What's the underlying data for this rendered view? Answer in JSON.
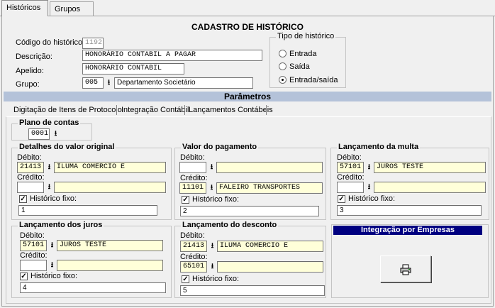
{
  "tabs": [
    {
      "label": "Históricos",
      "accel": "H"
    },
    {
      "label": "Grupos",
      "accel": "G"
    }
  ],
  "form": {
    "title": "CADASTRO DE HISTÓRICO",
    "codigo_label": "Código do histórico:",
    "codigo_value": "1192",
    "descricao_label": "Descrição:",
    "descricao_value": "HONORÁRIO CONTABIL A PAGAR",
    "apelido_label": "Apelido:",
    "apelido_value": "HONORÁRIO CONTABIL",
    "grupo_label": "Grupo:",
    "grupo_code": "005",
    "grupo_name": "Departamento Societário"
  },
  "tipo": {
    "title": "Tipo de histórico",
    "options": [
      "Entrada",
      "Saída",
      "Entrada/saída"
    ],
    "selected": "Entrada/saída"
  },
  "parametros": {
    "title": "Parâmetros",
    "subtabs": [
      "Digitação de Itens de Protocolo",
      "Integração Contábil",
      "Lançamentos Contábeis"
    ],
    "active_subtab": "Lançamentos Contábeis"
  },
  "plano": {
    "title": "Plano de contas",
    "value": "0001"
  },
  "labels": {
    "debito": "Débito:",
    "credito": "Crédito:",
    "historico_fixo": "Histórico fixo:"
  },
  "groups": {
    "valor_original": {
      "title": "Detalhes do valor original",
      "debito_code": "21413",
      "debito_name": "ILUMA COMERCIO E",
      "credito_code": "",
      "credito_name": "",
      "hist_checked": true,
      "hist_value": "1"
    },
    "pagamento": {
      "title": "Valor do pagamento",
      "debito_code": "",
      "debito_name": "",
      "credito_code": "11101",
      "credito_name": "FALEIRO TRANSPORTES",
      "hist_checked": true,
      "hist_value": "2"
    },
    "multa": {
      "title": "Lançamento da multa",
      "debito_code": "57101",
      "debito_name": "JUROS TESTE",
      "credito_code": "",
      "credito_name": "",
      "hist_checked": true,
      "hist_value": "3"
    },
    "juros": {
      "title": "Lançamento dos juros",
      "debito_code": "57101",
      "debito_name": "JUROS TESTE",
      "credito_code": "",
      "credito_name": "",
      "hist_checked": true,
      "hist_value": "4"
    },
    "desconto": {
      "title": "Lançamento do desconto",
      "debito_code": "21413",
      "debito_name": "ILUMA COMERCIO E",
      "credito_code": "65101",
      "credito_name": "",
      "hist_checked": true,
      "hist_value": "5"
    }
  },
  "integracao": {
    "title": "Integração por Empresas",
    "button_icon": "printer-icon"
  }
}
